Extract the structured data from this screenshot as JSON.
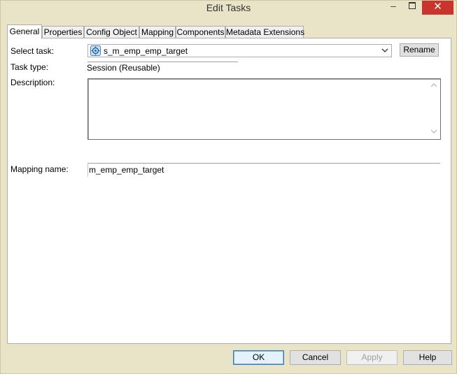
{
  "window": {
    "title": "Edit Tasks",
    "minimize_label": "–",
    "close_label": "✕"
  },
  "tabs": [
    {
      "label": "General",
      "active": true
    },
    {
      "label": "Properties",
      "active": false
    },
    {
      "label": "Config Object",
      "active": false
    },
    {
      "label": "Mapping",
      "active": false
    },
    {
      "label": "Components",
      "active": false
    },
    {
      "label": "Metadata Extensions",
      "active": false
    }
  ],
  "general": {
    "select_task_label": "Select task:",
    "select_task_value": "s_m_emp_emp_target",
    "select_task_icon": "session-icon",
    "rename_label": "Rename",
    "task_type_label": "Task type:",
    "task_type_value": "Session (Reusable)",
    "description_label": "Description:",
    "description_value": "",
    "mapping_name_label": "Mapping name:",
    "mapping_name_value": "m_emp_emp_target"
  },
  "buttons": {
    "ok": "OK",
    "cancel": "Cancel",
    "apply": "Apply",
    "help": "Help"
  },
  "colors": {
    "chrome": "#e9e3c7",
    "close": "#c7352c",
    "panel": "#ffffff"
  }
}
